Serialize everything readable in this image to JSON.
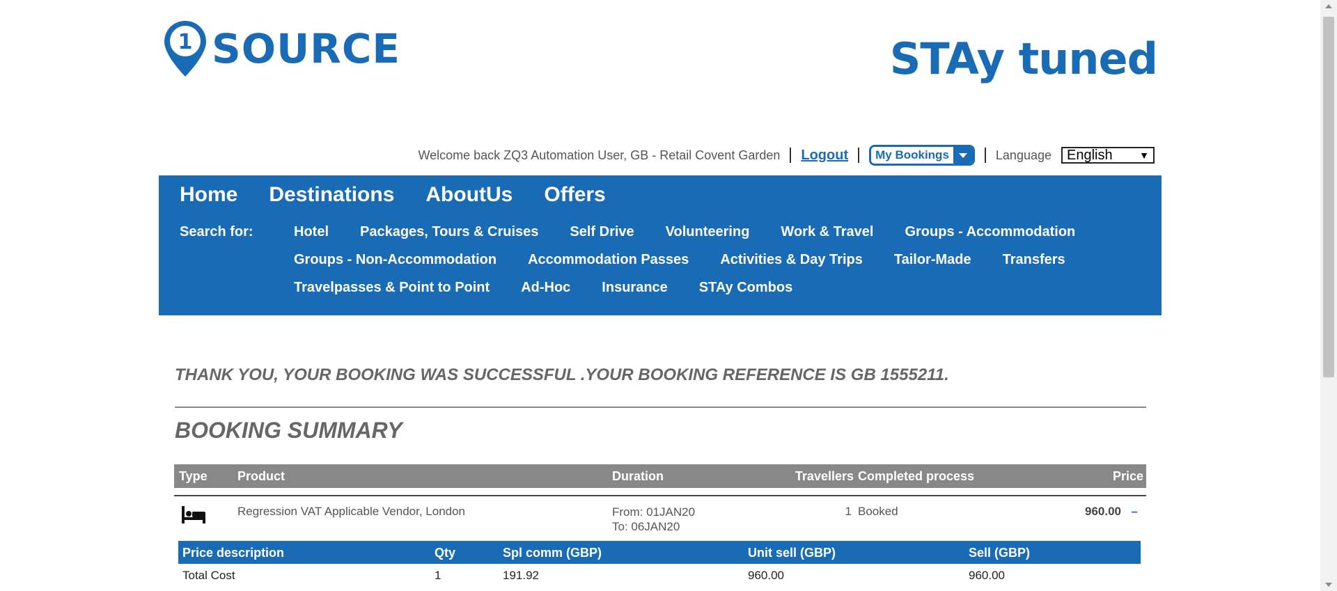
{
  "logos": {
    "left": "SOURCE",
    "left_number": "1",
    "right": "STAy tuned"
  },
  "userbar": {
    "welcome": "Welcome back ZQ3 Automation User, GB - Retail Covent Garden",
    "logout": "Logout",
    "my_bookings": "My Bookings",
    "language_label": "Language",
    "language_value": "English"
  },
  "nav": {
    "main": [
      "Home",
      "Destinations",
      "AboutUs",
      "Offers"
    ],
    "search_label": "Search for:",
    "rows": [
      [
        "Hotel",
        "Packages, Tours & Cruises",
        "Self Drive",
        "Volunteering",
        "Work & Travel",
        "Groups - Accommodation"
      ],
      [
        "Groups - Non-Accommodation",
        "Accommodation Passes",
        "Activities & Day Trips",
        "Tailor-Made",
        "Transfers"
      ],
      [
        "Travelpasses & Point to Point",
        "Ad-Hoc",
        "Insurance",
        "STAy Combos"
      ]
    ]
  },
  "content": {
    "thanks": "THANK YOU, YOUR BOOKING WAS SUCCESSFUL .YOUR BOOKING REFERENCE IS GB 1555211.",
    "summary_title": "BOOKING SUMMARY"
  },
  "booking_table": {
    "headers": {
      "type": "Type",
      "product": "Product",
      "duration": "Duration",
      "travellers": "Travellers",
      "completed": "Completed process",
      "price": "Price"
    },
    "row": {
      "icon": "bed-icon",
      "product": "Regression VAT Applicable Vendor, London",
      "from": "From: 01JAN20",
      "to": "To: 06JAN20",
      "travellers": "1",
      "completed": "Booked",
      "price": "960.00",
      "toggle": "–"
    }
  },
  "price_table": {
    "headers": {
      "description": "Price description",
      "qty": "Qty",
      "spl_comm": "Spl comm (GBP)",
      "unit_sell": "Unit sell (GBP)",
      "sell": "Sell (GBP)"
    },
    "row": {
      "description": "Total Cost",
      "qty": "1",
      "spl_comm": "191.92",
      "unit_sell": "960.00",
      "sell": "960.00"
    }
  },
  "colors": {
    "brand_blue": "#1a6bb5",
    "header_gray": "#888888"
  }
}
